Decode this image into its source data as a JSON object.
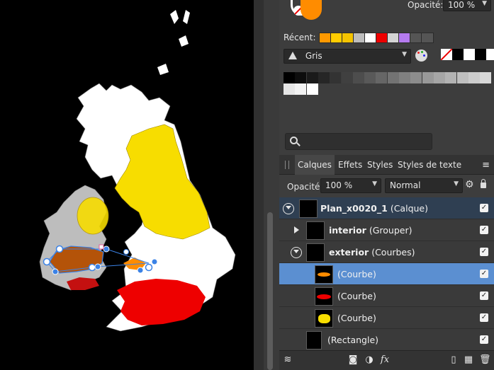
{
  "canvas": {
    "map_colors": {
      "land": "#ffffff",
      "ireland": "#bdbdbd",
      "scotland_yellow": "#f7dd00",
      "red": "#ee0000",
      "orange": "#ff8c00",
      "brown": "#b45309",
      "selection": "#3b82e6"
    }
  },
  "color_panel": {
    "opacity_label": "Opacité:",
    "opacity_value": "100 %",
    "fill_color": "#ff8c00",
    "recent_label": "Récent:",
    "recent_colors": [
      "#ff9900",
      "#ffcc00",
      "#f5c400",
      "#bdbdbd",
      "#ffffff",
      "#ee0000",
      "#d4d4d4",
      "#b57bef",
      "#555555",
      "#555555"
    ],
    "palette_name": "Gris",
    "grays_row1": [
      "#000000",
      "#0d0d0d",
      "#1a1a1a",
      "#262626",
      "#333333",
      "#404040",
      "#4d4d4d",
      "#595959",
      "#666666",
      "#737373",
      "#808080",
      "#8c8c8c",
      "#999999",
      "#a6a6a6",
      "#b3b3b3",
      "#bfbfbf",
      "#cccccc",
      "#d9d9d9"
    ],
    "grays_row2": [
      "#e6e6e6",
      "#f2f2f2",
      "#ffffff"
    ]
  },
  "tabs": {
    "items": [
      "Calques",
      "Effets",
      "Styles",
      "Styles de texte"
    ]
  },
  "layers_panel": {
    "opacity_label": "Opacité:",
    "opacity_value": "100 %",
    "blend_mode": "Normal",
    "layers": [
      {
        "bold": "Plan_x0020_1",
        "type": "(Calque)"
      },
      {
        "bold": "interior",
        "type": "(Grouper)"
      },
      {
        "bold": "exterior",
        "type": "(Courbes)"
      },
      {
        "bold": "",
        "type": "(Courbe)"
      },
      {
        "bold": "",
        "type": "(Courbe)"
      },
      {
        "bold": "",
        "type": "(Courbe)"
      },
      {
        "bold": "",
        "type": "(Rectangle)"
      }
    ]
  },
  "icons": {
    "search": "search-icon",
    "palette": "palette-icon",
    "menu": "menu-icon",
    "gear": "gear-icon",
    "lock": "lock-icon",
    "fx": "fx"
  }
}
